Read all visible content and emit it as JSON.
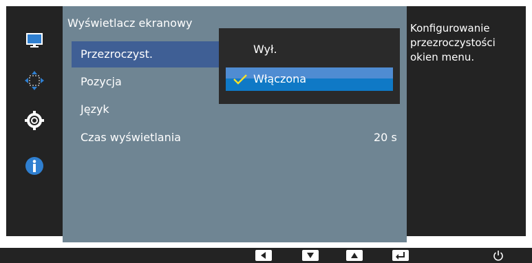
{
  "colors": {
    "menu_background": "#6f8593",
    "dark_panel": "#232323",
    "submenu_background": "#2a2a2a",
    "highlight": "#3f5f95",
    "selected_option": "#0f79c6",
    "check_color": "#f5e02a"
  },
  "sidebar": {
    "tabs": [
      {
        "icon": "monitor-icon"
      },
      {
        "icon": "move-arrows-icon"
      },
      {
        "icon": "gear-icon"
      },
      {
        "icon": "info-icon"
      }
    ]
  },
  "menu": {
    "title": "Wyświetlacz ekranowy",
    "items": [
      {
        "label": "Przezroczyst.",
        "value": ""
      },
      {
        "label": "Pozycja",
        "value": ""
      },
      {
        "label": "Język",
        "value": ""
      },
      {
        "label": "Czas wyświetlania",
        "value": "20 s"
      }
    ]
  },
  "submenu": {
    "options": [
      {
        "label": "Wył.",
        "selected": false
      },
      {
        "label": "Włączona",
        "selected": true
      }
    ]
  },
  "help": {
    "text": "Konfigurowanie przezroczystości okien menu."
  },
  "footer": {
    "buttons": [
      "left-arrow-icon",
      "down-arrow-icon",
      "up-arrow-icon",
      "enter-icon"
    ],
    "power_icon": "power-icon"
  }
}
